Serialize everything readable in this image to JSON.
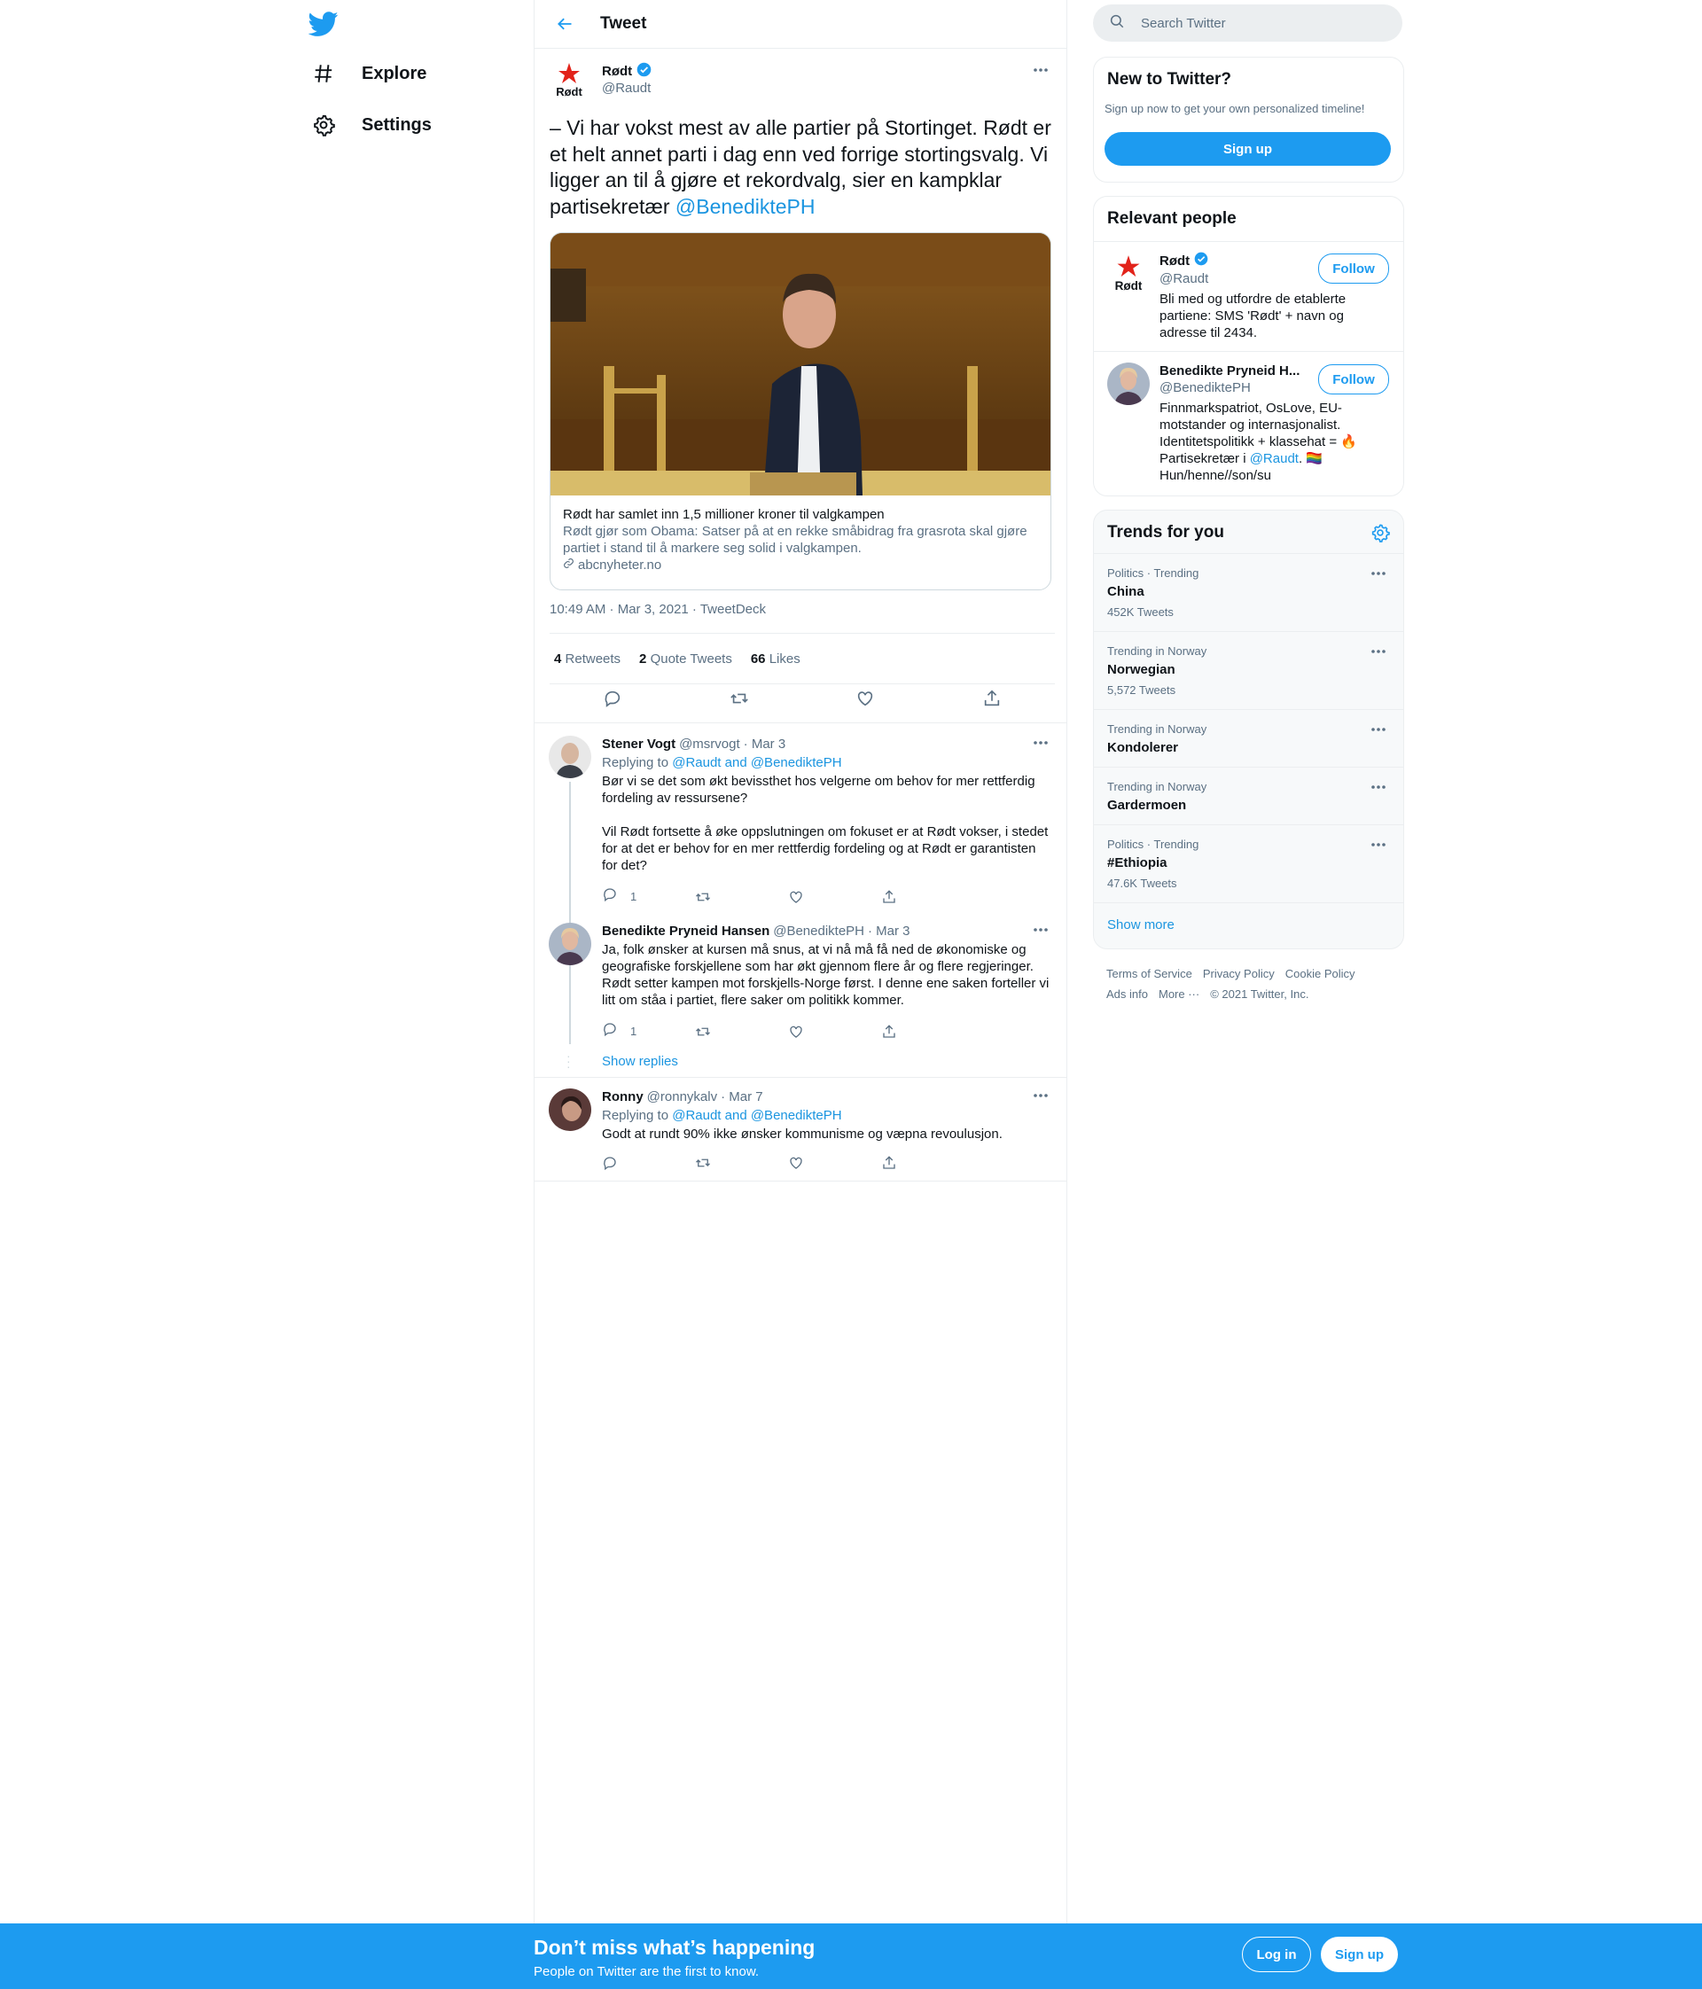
{
  "nav": {
    "logo_icon": "twitter-bird-icon",
    "items": [
      {
        "label": "Explore",
        "icon": "hashtag-icon"
      },
      {
        "label": "Settings",
        "icon": "gear-icon"
      }
    ]
  },
  "header": {
    "title": "Tweet",
    "back_icon": "back-arrow-icon"
  },
  "main_tweet": {
    "author": {
      "name": "Rødt",
      "handle": "@Raudt",
      "verified": true,
      "avatar_text": "Rødt"
    },
    "text_before_mention": "– Vi har vokst mest av alle partier på Stortinget. Rødt er et helt annet parti i dag enn ved forrige stortingsvalg. Vi ligger an til å gjøre et rekordvalg, sier en kampklar partisekretær ",
    "mention": "@BenediktePH",
    "card": {
      "title": "Rødt har samlet inn 1,5 millioner kroner til valgkampen",
      "description": "Rødt gjør som Obama: Satser på at en rekke småbidrag fra grasrota skal gjøre partiet i stand til å markere seg solid i valgkampen.",
      "domain": "abcnyheter.no"
    },
    "timestamp": "10:49 AM · Mar 3, 2021",
    "source": "TweetDeck",
    "stats": {
      "retweets": "4",
      "retweets_label": "Retweets",
      "quotes": "2",
      "quotes_label": "Quote Tweets",
      "likes": "66",
      "likes_label": "Likes"
    }
  },
  "replies": [
    {
      "name": "Stener Vogt",
      "handle": "@msrvogt",
      "date": "· Mar 3",
      "replying_to_label": "Replying to",
      "replying_to": "@Raudt and @BenediktePH",
      "text": "Bør vi se det som økt bevissthet hos velgerne om behov for mer rettferdig fordeling av ressursene?\n\nVil Rødt fortsette å øke oppslutningen om fokuset er at Rødt vokser, i stedet for at det er behov for en mer rettferdig fordeling og at Rødt er garantisten for det?",
      "reply_count": "1"
    },
    {
      "name": "Benedikte Pryneid Hansen",
      "handle": "@BenediktePH",
      "date": "· Mar 3",
      "text": "Ja, folk ønsker at kursen må snus, at vi nå må få ned de økonomiske og geografiske forskjellene som har økt gjennom flere år og flere regjeringer. Rødt setter kampen mot forskjells-Norge først. I denne ene saken forteller vi litt om ståa i partiet, flere saker om politikk kommer.",
      "reply_count": "1",
      "show_replies": "Show replies"
    },
    {
      "name": "Ronny",
      "handle": "@ronnykalv",
      "date": "· Mar 7",
      "replying_to_label": "Replying to",
      "replying_to": "@Raudt and @BenediktePH",
      "text": "Godt at rundt 90% ikke ønsker kommunisme og væpna revoulusjon.",
      "reply_count": ""
    }
  ],
  "search": {
    "placeholder": "Search Twitter"
  },
  "new_to_twitter": {
    "title": "New to Twitter?",
    "subtitle": "Sign up now to get your own personalized timeline!",
    "button": "Sign up"
  },
  "relevant_people": {
    "title": "Relevant people",
    "people": [
      {
        "name": "Rødt",
        "handle": "@Raudt",
        "verified": true,
        "follow": "Follow",
        "bio": "Bli med og utfordre de etablerte partiene: SMS 'Rødt' + navn og adresse til 2434."
      },
      {
        "name": "Benedikte Pryneid H...",
        "handle": "@BenediktePH",
        "follow": "Follow",
        "bio_part1": "Finnmarkspatriot, OsLove, EU-motstander og internasjonalist. Identitetspolitikk + klassehat = 🔥 Partisekretær i ",
        "bio_mention": "@Raudt",
        "bio_part2": ". 🏳️‍🌈 Hun/henne//son/su"
      }
    ]
  },
  "trends": {
    "title": "Trends for you",
    "settings_icon": "gear-icon",
    "items": [
      {
        "meta": "Politics · Trending",
        "name": "China",
        "count": "452K Tweets"
      },
      {
        "meta": "Trending in Norway",
        "name": "Norwegian",
        "count": "5,572 Tweets"
      },
      {
        "meta": "Trending in Norway",
        "name": "Kondolerer",
        "count": ""
      },
      {
        "meta": "Trending in Norway",
        "name": "Gardermoen",
        "count": ""
      },
      {
        "meta": "Politics · Trending",
        "name": "#Ethiopia",
        "count": "47.6K Tweets"
      }
    ],
    "show_more": "Show more"
  },
  "footer": {
    "links_row1": [
      "Terms of Service",
      "Privacy Policy",
      "Cookie Policy"
    ],
    "ads_info": "Ads info",
    "more": "More ···",
    "copyright": "© 2021 Twitter, Inc."
  },
  "bottom_bar": {
    "title": "Don’t miss what’s happening",
    "subtitle": "People on Twitter are the first to know.",
    "login": "Log in",
    "signup": "Sign up"
  },
  "colors": {
    "accent": "#1d9bf0",
    "link": "#1b95e0",
    "text": "#0f1419",
    "muted": "#5b7083",
    "border": "#ebeef0"
  }
}
